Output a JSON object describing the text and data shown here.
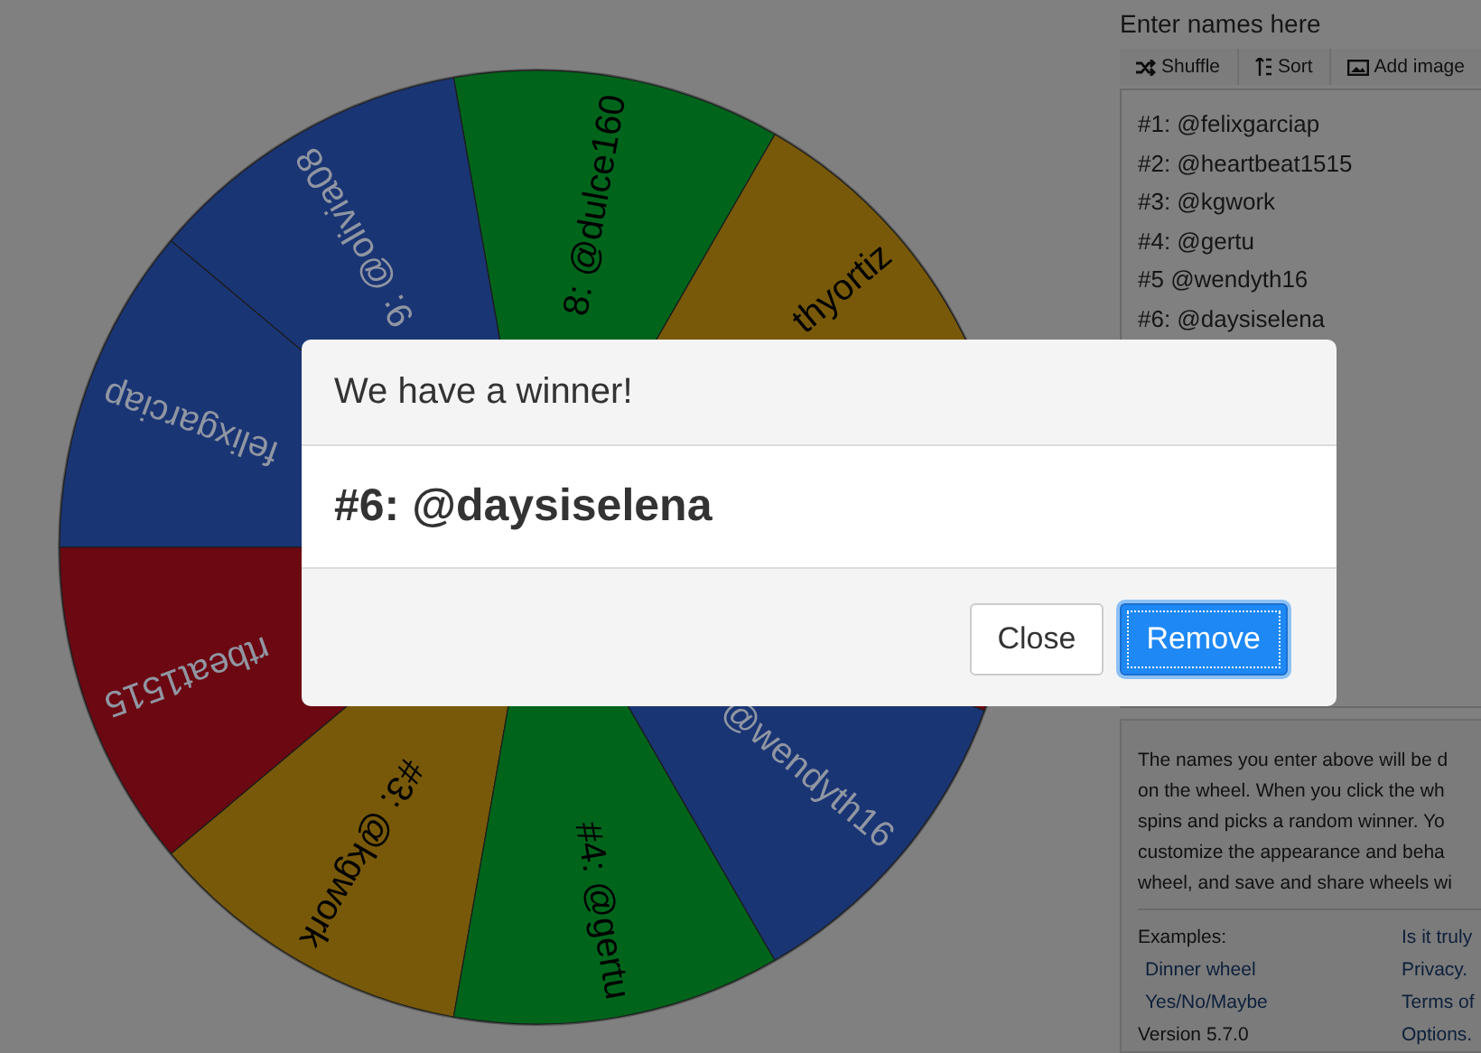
{
  "wheel": {
    "segments": [
      {
        "label": "felixgarciap",
        "color": "#1a3574"
      },
      {
        "label": "rtbeat1515",
        "color": "#6b0812"
      },
      {
        "label": "#3: @kgwork",
        "color": "#775909"
      },
      {
        "label": "#4: @gertu",
        "color": "#00651b"
      },
      {
        "label": "@wendyth16",
        "color": "#1a3574"
      },
      {
        "color": "#6b0812"
      },
      {
        "label": "thyortiz",
        "color": "#775909"
      },
      {
        "label": "8: @dulce160",
        "color": "#00651b"
      },
      {
        "label": "9: @olivia08",
        "color": "#1a3574"
      }
    ]
  },
  "names_panel": {
    "title": "Enter names here",
    "toolbar": [
      {
        "label": "Shuffle",
        "kind": "shuffle"
      },
      {
        "label": "Sort",
        "kind": "sort"
      },
      {
        "label": "Add image",
        "kind": "image"
      }
    ],
    "names": [
      "#1: @felixgarciap",
      "#2: @heartbeat1515",
      "#3: @kgwork",
      "#4: @gertu",
      "#5 @wendyth16",
      "#6: @daysiselena"
    ]
  },
  "info_panel": {
    "lines": [
      "The names you enter above will be d",
      "on the wheel. When you click the wh",
      "spins and picks a random winner. Yo",
      "customize the appearance and beha",
      "wheel, and save and share wheels wi"
    ],
    "links_left": [
      {
        "label": "Examples:",
        "kind": "heading"
      },
      {
        "label": "Dinner wheel",
        "kind": "link"
      },
      {
        "label": "Yes/No/Maybe",
        "kind": "link"
      },
      {
        "label": "Version 5.7.0",
        "kind": "text"
      }
    ],
    "links_right": [
      {
        "label": "Is it truly",
        "kind": "link"
      },
      {
        "label": "Privacy.",
        "kind": "link"
      },
      {
        "label": "Terms of",
        "kind": "link"
      },
      {
        "label": "Options.",
        "kind": "link"
      }
    ]
  },
  "dialog": {
    "title": "We have a winner!",
    "winner": "#6: @daysiselena",
    "buttons": [
      {
        "label": "Close",
        "kind": "default"
      },
      {
        "label": "Remove",
        "kind": "primary"
      }
    ]
  }
}
